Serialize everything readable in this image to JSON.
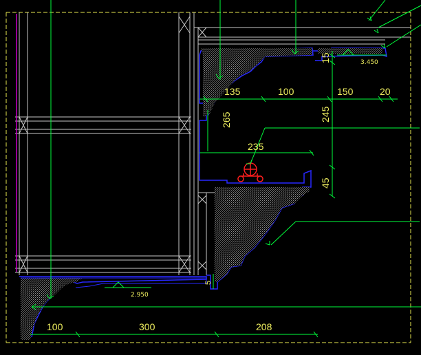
{
  "drawing": {
    "colors": {
      "background": "#000000",
      "grid": "#c8c8c8",
      "frame_yellow": "#e6e650",
      "leader_green": "#00ff3c",
      "profile_blue": "#2828ff",
      "pipe_red": "#ff1e1e",
      "accent_magenta": "#c800c8",
      "text_yellow": "#f0f060"
    },
    "dimensions": {
      "top_135": "135",
      "top_100": "100",
      "top_150": "150",
      "top_20": "20",
      "vert_15": "15",
      "vert_265": "265",
      "vert_245": "245",
      "mid_235": "235",
      "vert_45": "45",
      "vert_5": "5",
      "bottom_100": "100",
      "bottom_300": "300",
      "bottom_208": "208"
    },
    "levels": {
      "upper": "3.450",
      "lower": "2.950"
    },
    "icons": {
      "pipe": "pipe-section-symbol",
      "level_marker": "elevation-triangle"
    }
  }
}
